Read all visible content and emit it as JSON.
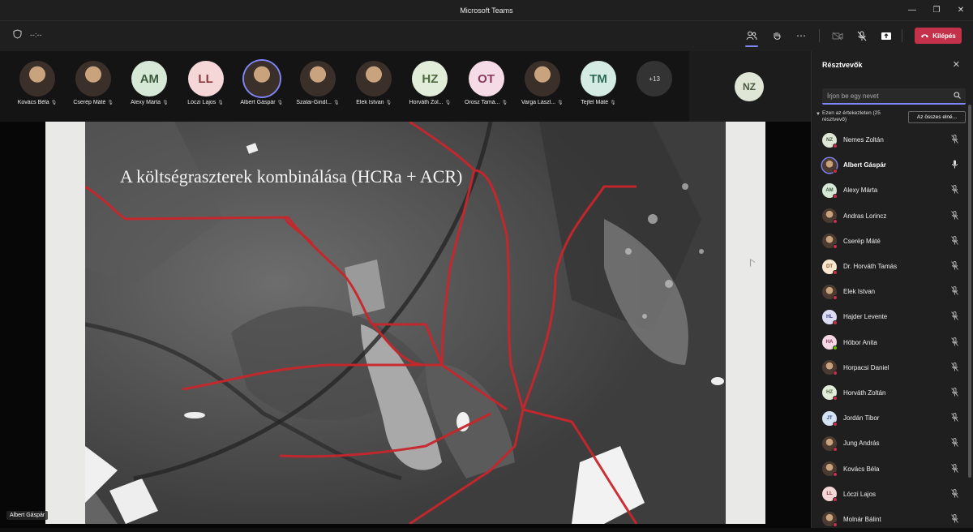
{
  "window": {
    "title": "Microsoft Teams"
  },
  "toolbar": {
    "timer": "--:--",
    "leave_label": "Kilépés"
  },
  "gallery": {
    "tiles": [
      {
        "name": "Kovács Béla",
        "initials": ""
      },
      {
        "name": "Cserép Máté",
        "initials": ""
      },
      {
        "name": "Alexy Márta",
        "initials": "AM"
      },
      {
        "name": "Lóczi Lajos",
        "initials": "LL"
      },
      {
        "name": "Albert Gáspár",
        "initials": ""
      },
      {
        "name": "Szalai-Gindl...",
        "initials": ""
      },
      {
        "name": "Elek Istvan",
        "initials": ""
      },
      {
        "name": "Horváth Zol...",
        "initials": "HZ"
      },
      {
        "name": "Orosz Tamá...",
        "initials": "OT"
      },
      {
        "name": "Varga Lászl...",
        "initials": ""
      },
      {
        "name": "Tejfel Máté",
        "initials": "TM"
      }
    ],
    "more_label": "+13",
    "self_initials": "NZ"
  },
  "stage": {
    "slide_title": "A költségraszterek kombinálása (HCRa + ACR)",
    "presenter_label": "Albert Gáspár"
  },
  "panel": {
    "title": "Résztvevők",
    "search_placeholder": "Írjon be egy nevet",
    "meeting_label": "Ezen az értekezleten (25 résztvevő)",
    "mute_all_label": "Az összes elné...",
    "participants": [
      {
        "name": "Nemes Zoltán",
        "initials": "NZ",
        "mic": "muted"
      },
      {
        "name": "Albert Gáspár",
        "initials": "",
        "mic": "on"
      },
      {
        "name": "Alexy Márta",
        "initials": "AM",
        "mic": "muted"
      },
      {
        "name": "Andras Lorincz",
        "initials": "",
        "mic": "muted"
      },
      {
        "name": "Cserép Máté",
        "initials": "",
        "mic": "muted"
      },
      {
        "name": "Dr. Horváth Tamás",
        "initials": "DT",
        "mic": "muted"
      },
      {
        "name": "Elek Istvan",
        "initials": "",
        "mic": "muted"
      },
      {
        "name": "Hajder Levente",
        "initials": "HL",
        "mic": "muted"
      },
      {
        "name": "Hóbor Anita",
        "initials": "HA",
        "mic": "muted"
      },
      {
        "name": "Horpacsi Daniel",
        "initials": "",
        "mic": "muted"
      },
      {
        "name": "Horváth Zoltán",
        "initials": "HZ",
        "mic": "muted"
      },
      {
        "name": "Jordán Tibor",
        "initials": "JT",
        "mic": "muted"
      },
      {
        "name": "Jung András",
        "initials": "",
        "mic": "muted"
      },
      {
        "name": "Kovács Béla",
        "initials": "",
        "mic": "muted"
      },
      {
        "name": "Lóczi Lajos",
        "initials": "LL",
        "mic": "muted"
      },
      {
        "name": "Molnár Bálint",
        "initials": "",
        "mic": "muted"
      }
    ]
  },
  "colors": {
    "accent": "#7f85f5",
    "leave": "#c4314b",
    "route": "#c8262b"
  }
}
